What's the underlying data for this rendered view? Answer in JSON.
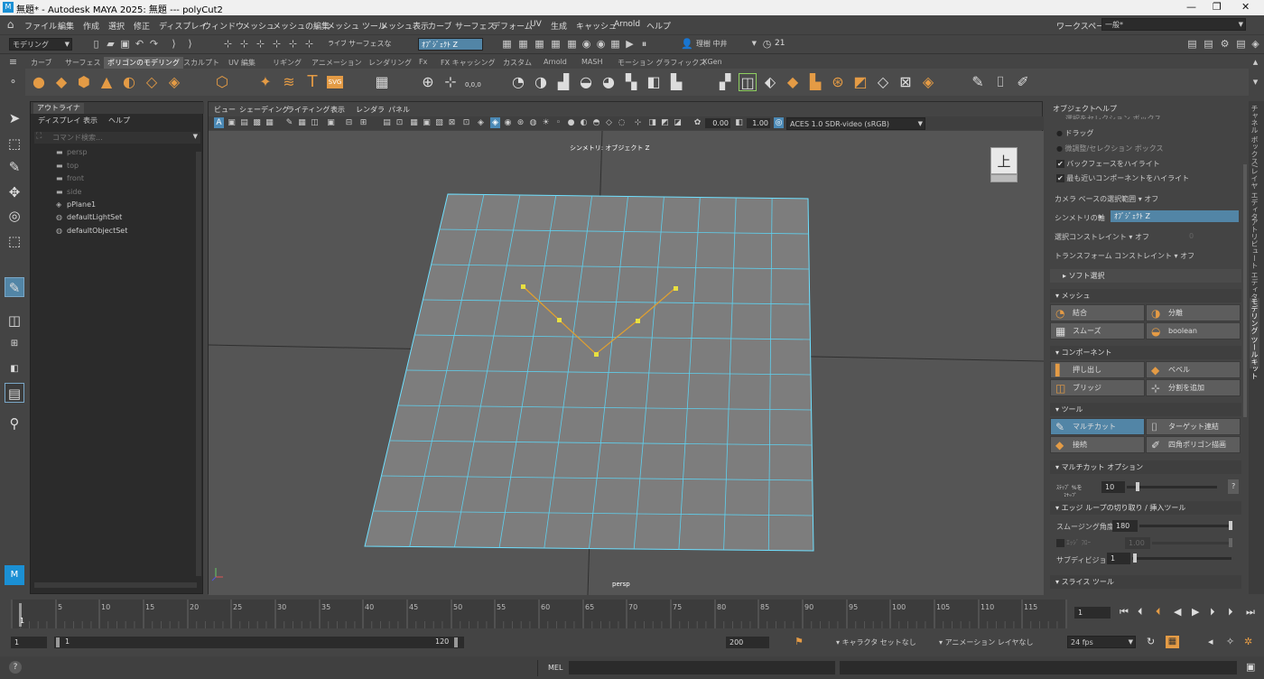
{
  "titlebar": {
    "title": "無題* - Autodesk MAYA 2025: 無題   ---   polyCut2",
    "icon": "maya-icon",
    "minimize": "—",
    "restore": "❐",
    "close": "✕"
  },
  "menubar": {
    "home_icon": "home-icon",
    "items": [
      "ファイル",
      "編集",
      "作成",
      "選択",
      "修正",
      "ディスプレイ",
      "ウィンドウ",
      "メッシュ",
      "メッシュの編集",
      "メッシュ ツール",
      "メッシュ表示",
      "カーブ",
      "サーフェス",
      "デフォーム",
      "UV",
      "生成",
      "キャッシュ",
      "Arnold",
      "ヘルプ"
    ],
    "workspace_label": "ワークスペース:",
    "workspace_value": "一般*"
  },
  "statusline": {
    "mode": "モデリング",
    "live_label": "ライブ",
    "live_value": "サーフェスなし",
    "symmetry_value": "ｵﾌﾞｼﾞｪｸﾄ Z",
    "user": "理樹 中井",
    "notifications": "21"
  },
  "shelf": {
    "tabs": [
      "カーブ",
      "サーフェス",
      "ポリゴンのモデリング",
      "スカルプト",
      "UV 編集",
      "リギング",
      "アニメーション",
      "レンダリング",
      "Fx",
      "FX キャッシング",
      "カスタム",
      "Arnold",
      "MASH",
      "モーション グラフィックス",
      "XGen"
    ],
    "active_tab": "ポリゴンのモデリング",
    "text_icon": "T",
    "svg_icon": "SVG",
    "coord_text": "0,0,0"
  },
  "outliner": {
    "tab": "アウトライナ",
    "menu": [
      "ディスプレイ",
      "表示",
      "ヘルプ"
    ],
    "search_placeholder": "コマンド検索...",
    "items": [
      {
        "label": "persp",
        "icon": "camera-icon",
        "dim": true
      },
      {
        "label": "top",
        "icon": "camera-icon",
        "dim": true
      },
      {
        "label": "front",
        "icon": "camera-icon",
        "dim": true
      },
      {
        "label": "side",
        "icon": "camera-icon",
        "dim": true
      },
      {
        "label": "pPlane1",
        "icon": "mesh-icon",
        "dim": false
      },
      {
        "label": "defaultLightSet",
        "icon": "set-icon",
        "dim": false
      },
      {
        "label": "defaultObjectSet",
        "icon": "set-icon",
        "dim": false
      }
    ]
  },
  "viewport": {
    "menu": [
      "ビュー",
      "シェーディング",
      "ライティング",
      "表示",
      "レンダラ",
      "パネル"
    ],
    "exposure": "0.00",
    "gamma": "1.00",
    "color_space": "ACES 1.0 SDR-video (sRGB)",
    "symmetry_label": "シンメトリ: オブジェクト Z",
    "camera_label": "persp",
    "viewcube_label": "上"
  },
  "modeling_toolkit": {
    "menu": [
      "オブジェクト",
      "ヘルプ"
    ],
    "cut_row": "選択をセレクション ボックス",
    "drag": "ドラッグ",
    "tweak_box": "微調整/セレクション ボックス",
    "backface_highlight": "バックフェースをハイライト",
    "nearest_highlight": "最も近いコンポーネントをハイライト",
    "camera_based_label": "カメラ ベースの選択範囲",
    "camera_based_value": "オフ",
    "symmetry_axis_label": "シンメトリの軸",
    "symmetry_axis_value": "ｵﾌﾞｼﾞｪｸﾄ Z",
    "select_constraint_label": "選択コンストレイント",
    "select_constraint_value": "オフ",
    "select_constraint_num": "0",
    "transform_constraint_label": "トランスフォーム コンストレイント",
    "transform_constraint_value": "オフ",
    "soft_select": "ソフト選択",
    "mesh_section": "メッシュ",
    "combine": "結合",
    "separate": "分離",
    "smooth": "スムーズ",
    "boolean": "boolean",
    "component_section": "コンポーネント",
    "extrude": "押し出し",
    "bevel": "ベベル",
    "bridge": "ブリッジ",
    "add_divisions": "分割を追加",
    "tools_section": "ツール",
    "multicut": "マルチカット",
    "target_weld": "ターゲット連結",
    "connect": "接続",
    "quad_draw": "四角ポリゴン描画",
    "multicut_options": "マルチカット オプション",
    "step_label": "ｽﾃｯﾌﾟ %を",
    "step_label2": "ｽﾅｯﾌﾟ",
    "step_value": "10",
    "step_fraction": 0.1,
    "help": "?",
    "edge_loop_section": "エッジ ループの切り取り / 挿入ツール",
    "smoothing_angle_label": "スムージング角度",
    "smoothing_angle_value": "180",
    "edge_flow_label": "ｴｯｼﾞ ﾌﾛｰ",
    "edge_flow_value": "1.00",
    "subdivisions_label": "サブディビジョン",
    "subdivisions_value": "1",
    "slice_section": "スライス ツール"
  },
  "vertical_tabs": [
    "チャネル ボックス/レイヤ エディタ",
    "アトリビュート エディタ",
    "モデリング ツールキット"
  ],
  "timeline": {
    "ticks": [
      "1",
      "5",
      "10",
      "15",
      "20",
      "25",
      "30",
      "35",
      "40",
      "45",
      "50",
      "55",
      "60",
      "65",
      "70",
      "75",
      "80",
      "85",
      "90",
      "95",
      "100",
      "105",
      "110",
      "115",
      "12"
    ],
    "current_frame": "1"
  },
  "range": {
    "start": "1",
    "inner_start": "1",
    "inner_end": "120",
    "end": "200",
    "character_set": "キャラクタ セットなし",
    "anim_layer": "アニメーション レイヤなし",
    "fps": "24 fps"
  },
  "cmdline": {
    "help_icon": "?",
    "lang": "MEL"
  }
}
